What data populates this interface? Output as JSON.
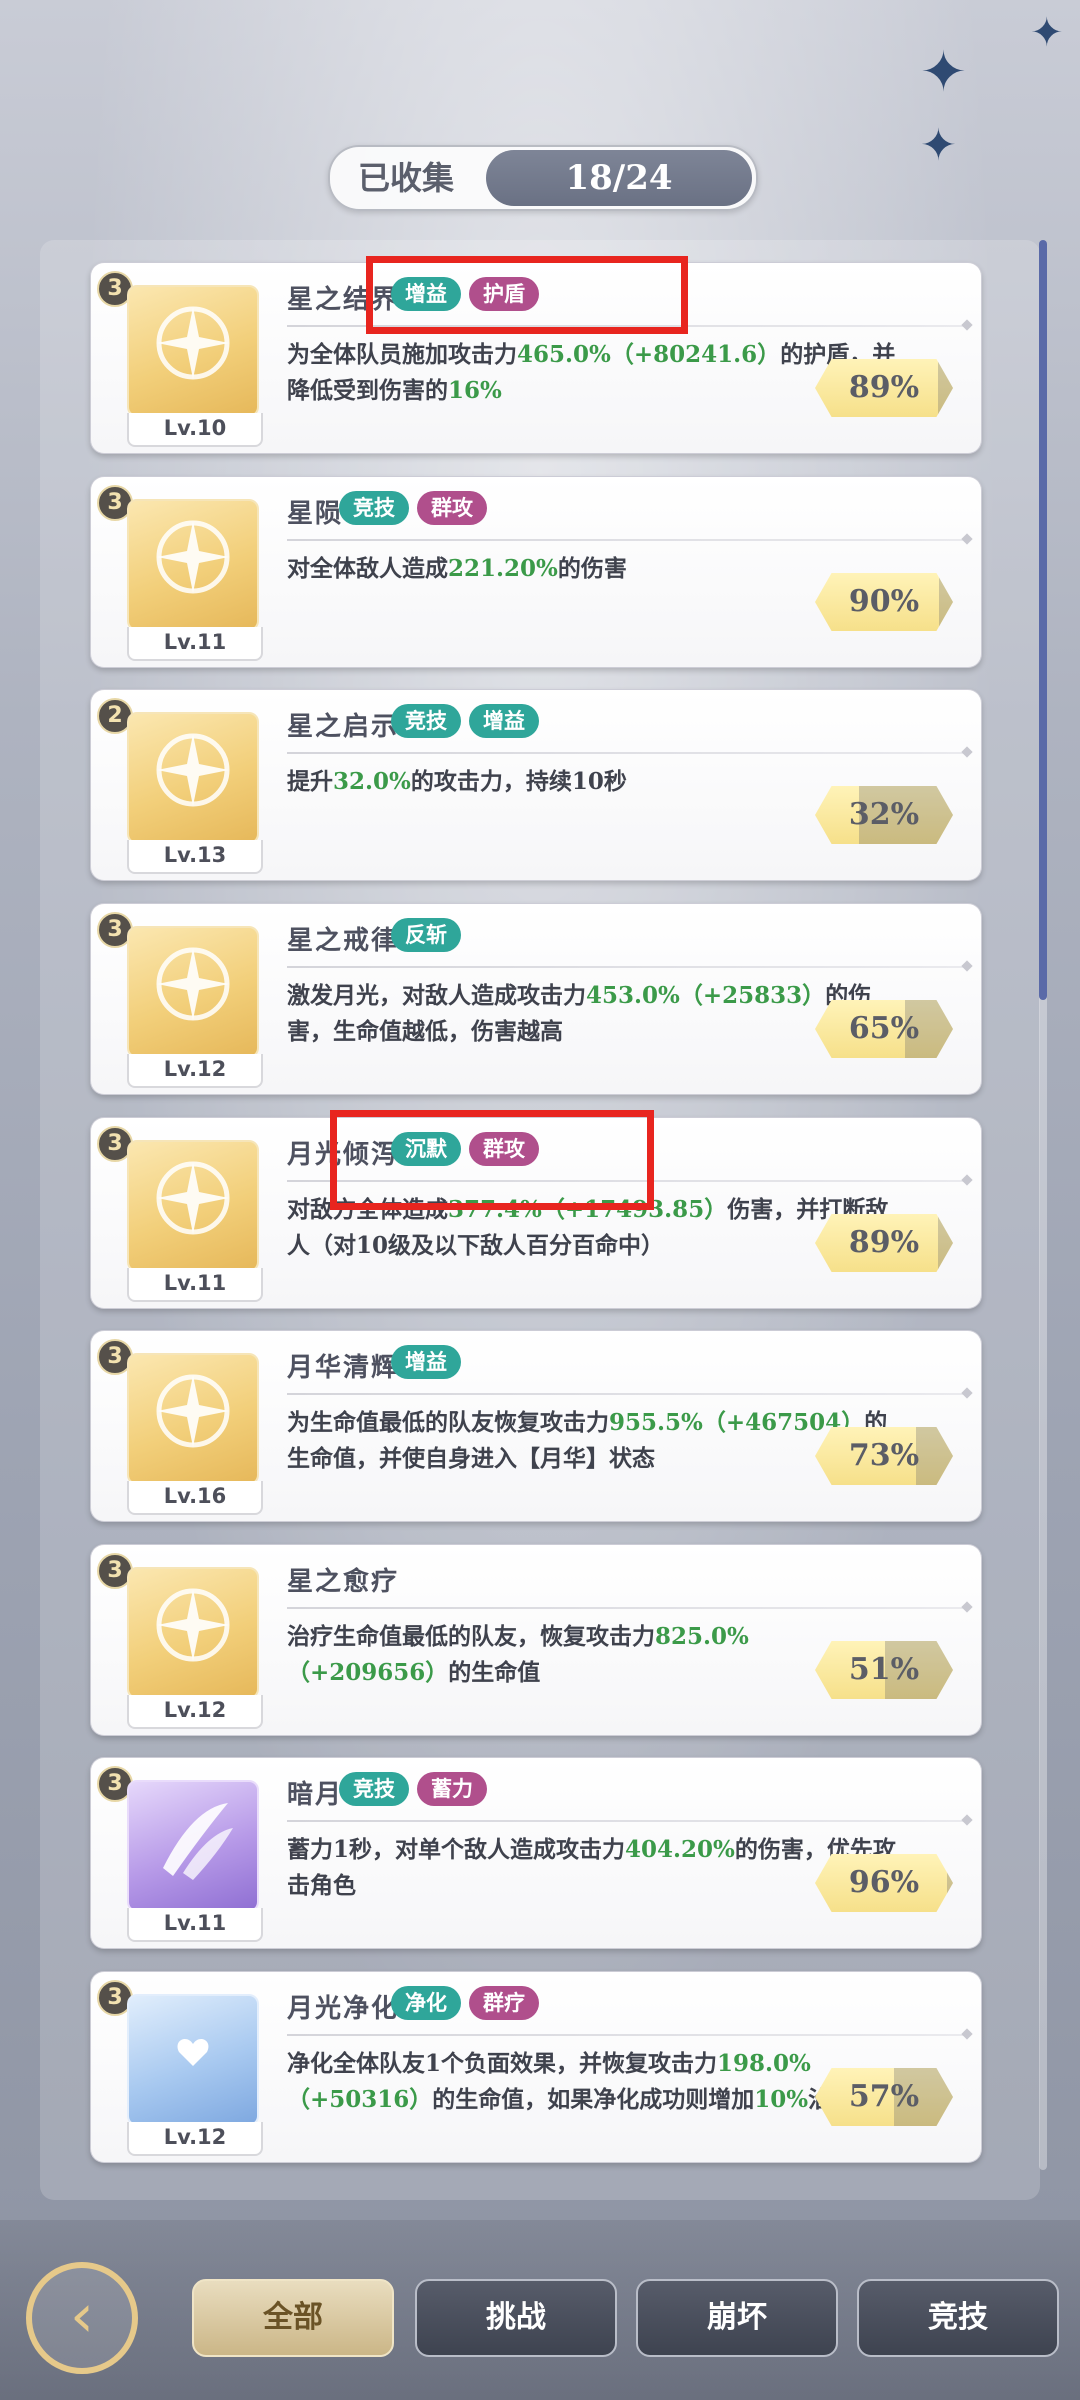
{
  "header": {
    "collected_label": "已收集",
    "collected_count": "18/24"
  },
  "cards": [
    {
      "rarity": "3",
      "level": "Lv.10",
      "name": "星之结界",
      "tags": [
        "增益",
        "护盾"
      ],
      "desc": [
        [
          "t",
          "为全体队员施加攻击力"
        ],
        [
          "g",
          "465.0%"
        ],
        [
          "g",
          "（+80241.6"
        ],
        [
          "g",
          "）"
        ],
        [
          "t",
          "的护盾，并降低受到伤害的"
        ],
        [
          "g",
          "16%"
        ]
      ],
      "pct": "89%",
      "pct_value": 89,
      "icon": "star-shield-icon",
      "color": "gold"
    },
    {
      "rarity": "3",
      "level": "Lv.11",
      "name": "星陨",
      "tags": [
        "竞技",
        "群攻"
      ],
      "desc": [
        [
          "t",
          "对全体敌人造成"
        ],
        [
          "g",
          "221.20%"
        ],
        [
          "t",
          "的伤害"
        ]
      ],
      "pct": "90%",
      "pct_value": 90,
      "icon": "meteor-icon",
      "color": "gold"
    },
    {
      "rarity": "2",
      "level": "Lv.13",
      "name": "星之启示",
      "tags": [
        "竞技",
        "增益"
      ],
      "desc": [
        [
          "t",
          "提升"
        ],
        [
          "g",
          "32.0%"
        ],
        [
          "t",
          "的攻击力，持续10秒"
        ]
      ],
      "pct": "32%",
      "pct_value": 32,
      "icon": "star-ship-icon",
      "color": "gold"
    },
    {
      "rarity": "3",
      "level": "Lv.12",
      "name": "星之戒律",
      "tags": [
        "反斩"
      ],
      "desc": [
        [
          "t",
          "激发月光，对敌人造成攻击力"
        ],
        [
          "g",
          "453.0%"
        ],
        [
          "g",
          "（+25"
        ],
        [
          "g",
          "833）"
        ],
        [
          "t",
          "的伤害，生命值越低，伤害越高"
        ]
      ],
      "pct": "65%",
      "pct_value": 65,
      "icon": "crescent-moon-icon",
      "color": "gold"
    },
    {
      "rarity": "3",
      "level": "Lv.11",
      "name": "月光倾泻",
      "tags": [
        "沉默",
        "群攻"
      ],
      "desc": [
        [
          "t",
          "对敌方全体造成"
        ],
        [
          "g",
          "377.4%"
        ],
        [
          "g",
          "（+17493.85）"
        ],
        [
          "t",
          "伤害，并打断敌人（对10级及以下敌人百分百命中）"
        ]
      ],
      "pct": "89%",
      "pct_value": 89,
      "icon": "moon-pendant-icon",
      "color": "gold"
    },
    {
      "rarity": "3",
      "level": "Lv.16",
      "name": "月华清辉",
      "tags": [
        "增益"
      ],
      "desc": [
        [
          "t",
          "为生命值最低的队友恢复攻击力"
        ],
        [
          "g",
          "955.5%"
        ],
        [
          "g",
          "（+4"
        ],
        [
          "g",
          "67504）"
        ],
        [
          "t",
          "的生命值，并使自身进入【月华】状态"
        ]
      ],
      "pct": "73%",
      "pct_value": 73,
      "icon": "praying-figure-icon",
      "color": "gold"
    },
    {
      "rarity": "3",
      "level": "Lv.12",
      "name": "星之愈疗",
      "tags": [],
      "desc": [
        [
          "t",
          "治疗生命值最低的队友，恢复攻击力"
        ],
        [
          "g",
          "825.0%"
        ],
        [
          "g",
          "（+209656）"
        ],
        [
          "t",
          "的生命值"
        ]
      ],
      "pct": "51%",
      "pct_value": 51,
      "icon": "healing-figure-icon",
      "color": "gold"
    },
    {
      "rarity": "3",
      "level": "Lv.11",
      "name": "暗月",
      "tags": [
        "竞技",
        "蓄力"
      ],
      "desc": [
        [
          "t",
          "蓄力1秒，对单个敌人造成攻击力"
        ],
        [
          "g",
          "404.20%"
        ],
        [
          "t",
          "的伤害，优先攻击角色"
        ]
      ],
      "pct": "96%",
      "pct_value": 96,
      "icon": "dark-moon-slash-icon",
      "color": "purple"
    },
    {
      "rarity": "3",
      "level": "Lv.12",
      "name": "月光净化",
      "tags": [
        "净化",
        "群疗"
      ],
      "desc": [
        [
          "t",
          "净化全体队友1个负面效果，并恢复攻击力"
        ],
        [
          "g",
          "198.0%"
        ],
        [
          "g",
          "（+50316）"
        ],
        [
          "t",
          "的生命值，如果净化成功则增加"
        ],
        [
          "g",
          "10%"
        ],
        [
          "t",
          "治疗量"
        ]
      ],
      "pct": "57%",
      "pct_value": 57,
      "icon": "heart-moon-icon",
      "color": "blue"
    }
  ],
  "tabs": {
    "all": "全部",
    "challenge": "挑战",
    "collapse": "崩坏",
    "arena": "竞技"
  },
  "colors": {
    "tag_teal": "#2fa69a",
    "tag_pink": "#b04f8c",
    "highlight_green": "#3b9a49",
    "annotation_red": "#e8251f"
  }
}
